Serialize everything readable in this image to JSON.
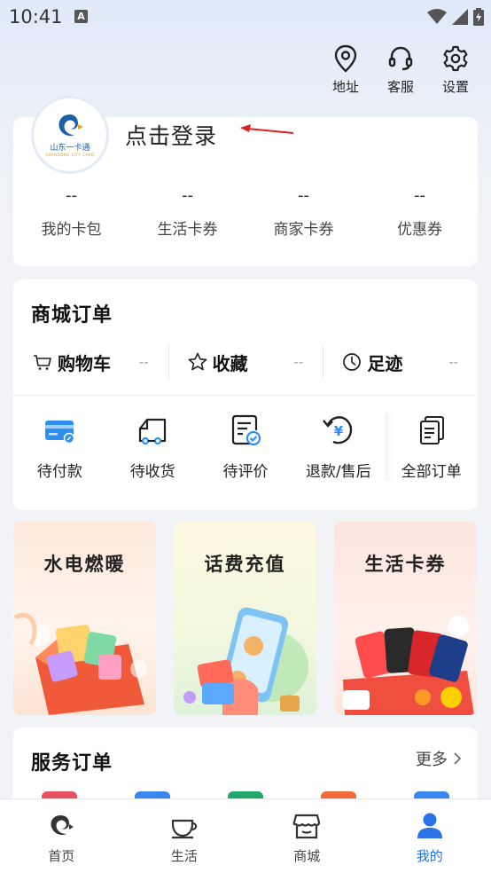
{
  "status_bar": {
    "time": "10:41",
    "notif_letter": "A"
  },
  "top_actions": [
    {
      "label": "地址",
      "icon": "location-pin-icon"
    },
    {
      "label": "客服",
      "icon": "headset-icon"
    },
    {
      "label": "设置",
      "icon": "gear-icon"
    }
  ],
  "profile": {
    "logo_text": "山东一卡通",
    "logo_subtext": "SHANDONG CITY CARD",
    "login_text": "点击登录",
    "stats": [
      {
        "value": "--",
        "label": "我的卡包"
      },
      {
        "value": "--",
        "label": "生活卡券"
      },
      {
        "value": "--",
        "label": "商家卡券"
      },
      {
        "value": "--",
        "label": "优惠券"
      }
    ]
  },
  "mall_orders": {
    "title": "商城订单",
    "shortcuts": [
      {
        "label": "购物车",
        "count": "--",
        "icon": "cart-icon"
      },
      {
        "label": "收藏",
        "count": "--",
        "icon": "star-icon"
      },
      {
        "label": "足迹",
        "count": "--",
        "icon": "clock-icon"
      }
    ],
    "statuses": [
      {
        "label": "待付款",
        "icon": "credit-card-icon"
      },
      {
        "label": "待收货",
        "icon": "delivery-truck-icon"
      },
      {
        "label": "待评价",
        "icon": "review-document-icon"
      },
      {
        "label": "退款/售后",
        "icon": "refund-icon"
      },
      {
        "label": "全部订单",
        "icon": "all-orders-icon"
      }
    ]
  },
  "tiles": [
    {
      "title": "水电燃暖"
    },
    {
      "title": "话费充值"
    },
    {
      "title": "生活卡券"
    }
  ],
  "service_orders": {
    "title": "服务订单",
    "more": "更多"
  },
  "bottom_nav": [
    {
      "label": "首页",
      "icon": "home-logo-icon"
    },
    {
      "label": "生活",
      "icon": "coffee-cup-icon"
    },
    {
      "label": "商城",
      "icon": "store-icon"
    },
    {
      "label": "我的",
      "icon": "person-icon",
      "active": true
    }
  ],
  "colors": {
    "accent": "#2a72e8",
    "arrow": "#e02020"
  }
}
